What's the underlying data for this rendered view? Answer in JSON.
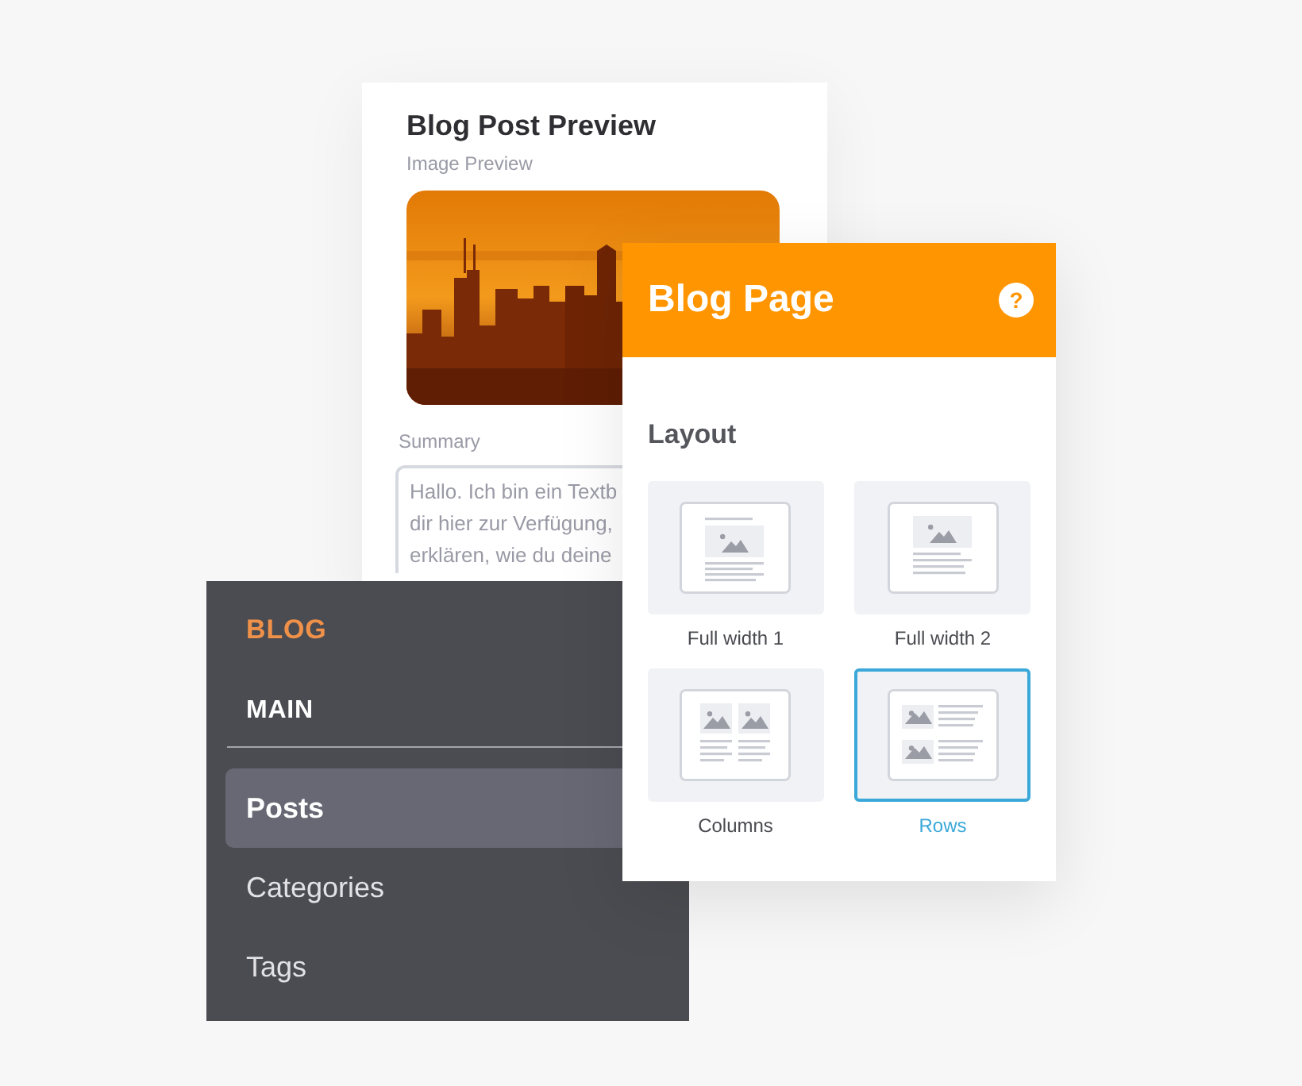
{
  "preview": {
    "title": "Blog Post Preview",
    "image_label": "Image Preview",
    "image": {
      "kind": "picture"
    },
    "summary_label": "Summary",
    "summary_lines": [
      "Hallo. Ich bin ein Textb",
      "dir hier zur Verfügung,",
      "erklären, wie du deine"
    ]
  },
  "sidebar": {
    "heading": "BLOG",
    "section": "MAIN",
    "items": [
      {
        "label": "Posts",
        "selected": true
      },
      {
        "label": "Categories",
        "selected": false
      },
      {
        "label": "Tags",
        "selected": false
      }
    ]
  },
  "panel": {
    "title": "Blog Page",
    "help": "?",
    "section": "Layout",
    "options": [
      {
        "kind": "full1",
        "label": "Full width 1",
        "selected": false
      },
      {
        "kind": "full2",
        "label": "Full width 2",
        "selected": false
      },
      {
        "kind": "columns",
        "label": "Columns",
        "selected": false
      },
      {
        "kind": "rows",
        "label": "Rows",
        "selected": true
      }
    ]
  }
}
